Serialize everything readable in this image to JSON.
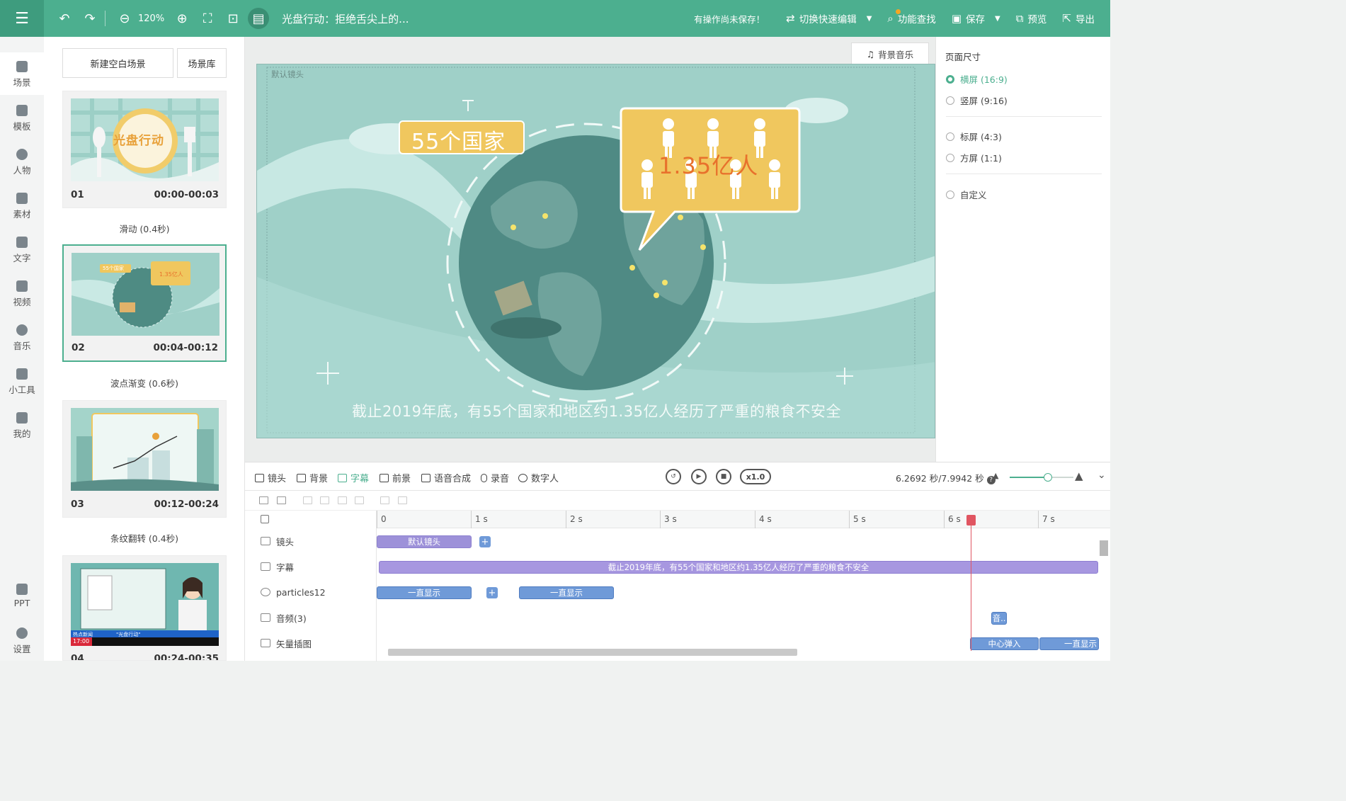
{
  "topbar": {
    "zoom": "120%",
    "doc_title": "光盘行动：拒绝舌尖上的...",
    "unsaved_notice": "有操作尚未保存！",
    "quick_edit": "切换快速编辑",
    "feature_search": "功能查找",
    "save": "保存",
    "preview": "预览",
    "export": "导出"
  },
  "nav": [
    "场景",
    "模板",
    "人物",
    "素材",
    "文字",
    "视频",
    "音乐",
    "小工具",
    "我的",
    "PPT",
    "设置"
  ],
  "scenes_panel": {
    "new_scene": "新建空白场景",
    "library": "场景库",
    "scenes": [
      {
        "index": "01",
        "time": "00:00-00:03",
        "transition": "滑动 (0.4秒)"
      },
      {
        "index": "02",
        "time": "00:04-00:12",
        "transition": "波点渐变 (0.6秒)"
      },
      {
        "index": "03",
        "time": "00:12-00:24",
        "transition": "条纹翻转 (0.4秒)"
      },
      {
        "index": "04",
        "time": "00:24-00:35",
        "transition": ""
      }
    ],
    "thumb_texts": {
      "t1": "光盘行动",
      "t2a": "55个国家",
      "t2b": "1.35亿人",
      "t4_news": "热点新闻",
      "t4_time": "17:00",
      "t4_tag": "\"光盘行动\""
    }
  },
  "canvas": {
    "bgm_button": "背景音乐",
    "lens_label": "默认镜头",
    "bubble_left": "55个国家",
    "bubble_right": "1.35亿人",
    "subtitle": "截止2019年底，有55个国家和地区约1.35亿人经历了严重的粮食不安全"
  },
  "right_panel": {
    "title": "页面尺寸",
    "options": [
      {
        "label": "横屏 (16:9)",
        "selected": true
      },
      {
        "label": "竖屏 (9:16)",
        "selected": false
      },
      {
        "label": "标屏 (4:3)",
        "selected": false
      },
      {
        "label": "方屏 (1:1)",
        "selected": false
      },
      {
        "label": "自定义",
        "selected": false
      }
    ]
  },
  "timeline": {
    "tabs": [
      "镜头",
      "背景",
      "字幕",
      "前景",
      "语音合成",
      "录音",
      "数字人"
    ],
    "active_tab": "字幕",
    "speed": "x1.0",
    "time_readout": "6.2692 秒/7.9942 秒",
    "zoom_fraction": 0.6,
    "ruler_labels": [
      "0",
      "1 s",
      "2 s",
      "3 s",
      "4 s",
      "5 s",
      "6 s",
      "7 s"
    ],
    "tracks": [
      {
        "name": "镜头",
        "clips": [
          "默认镜头"
        ]
      },
      {
        "name": "字幕",
        "clips": [
          "截止2019年底，有55个国家和地区约1.35亿人经历了严重的粮食不安全"
        ]
      },
      {
        "name": "particles12",
        "clips": [
          "一直显示",
          "一直显示"
        ]
      },
      {
        "name": "音频(3)",
        "clips": [
          "音.."
        ]
      },
      {
        "name": "矢量插图",
        "clips": [
          "中心弹入",
          "一直显示"
        ]
      }
    ]
  },
  "colors": {
    "brand": "#4caf8f",
    "stage_bg": "#9fd0c8",
    "bubble": "#f0c75e",
    "bubble_text_orange": "#e8712c",
    "playhead": "#e05561"
  }
}
